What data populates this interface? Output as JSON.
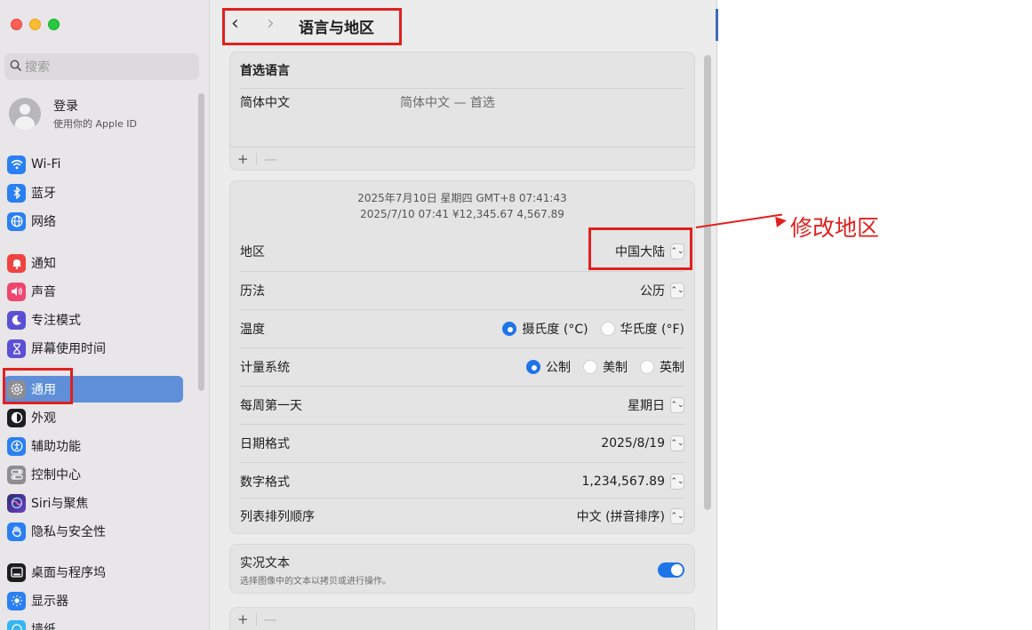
{
  "sidebar": {
    "search_placeholder": "搜索",
    "user": {
      "name": "登录",
      "subtitle": "使用你的 Apple ID"
    },
    "items": [
      {
        "label": "Wi-Fi",
        "icon": "wifi-icon",
        "color": "#2a7ff2"
      },
      {
        "label": "蓝牙",
        "icon": "bluetooth-icon",
        "color": "#2a7ff2"
      },
      {
        "label": "网络",
        "icon": "globe-icon",
        "color": "#2a7ff2"
      },
      {
        "label": "通知",
        "icon": "bell-icon",
        "color": "#ef4340"
      },
      {
        "label": "声音",
        "icon": "speaker-icon",
        "color": "#ef4670"
      },
      {
        "label": "专注模式",
        "icon": "moon-icon",
        "color": "#5b4fd6"
      },
      {
        "label": "屏幕使用时间",
        "icon": "hourglass-icon",
        "color": "#5b4fd6"
      },
      {
        "label": "通用",
        "icon": "gear-icon",
        "color": "#8d8d93"
      },
      {
        "label": "外观",
        "icon": "appearance-icon",
        "color": "#1d1d1f"
      },
      {
        "label": "辅助功能",
        "icon": "accessibility-icon",
        "color": "#2a7ff2"
      },
      {
        "label": "控制中心",
        "icon": "control-center-icon",
        "color": "#8d8d93"
      },
      {
        "label": "Siri与聚焦",
        "icon": "siri-icon",
        "color": "#3b3b6a"
      },
      {
        "label": "隐私与安全性",
        "icon": "hand-icon",
        "color": "#2a7ff2"
      },
      {
        "label": "桌面与程序坞",
        "icon": "dock-icon",
        "color": "#1d1d1f"
      },
      {
        "label": "显示器",
        "icon": "sun-icon",
        "color": "#2a7ff2"
      },
      {
        "label": "墙纸",
        "icon": "wallpaper-icon",
        "color": "#35b4f2"
      }
    ],
    "selected": "通用"
  },
  "toolbar": {
    "back": "‹",
    "forward": "›",
    "title": "语言与地区"
  },
  "preferred_languages": {
    "header": "首选语言",
    "languages": [
      {
        "name": "简体中文",
        "detail": "简体中文 — 首选"
      }
    ],
    "add": "+",
    "remove": "—"
  },
  "format_preview": {
    "line1": "2025年7月10日 星期四 GMT+8 07:41:43",
    "line2": "2025/7/10 07:41   ¥12,345.67   4,567.89"
  },
  "settings": {
    "region": {
      "label": "地区",
      "value": "中国大陆"
    },
    "calendar": {
      "label": "历法",
      "value": "公历"
    },
    "temperature": {
      "label": "温度",
      "options": [
        "摄氏度 (°C)",
        "华氏度 (°F)"
      ],
      "selected": "摄氏度 (°C)"
    },
    "measurement": {
      "label": "计量系统",
      "options": [
        "公制",
        "美制",
        "英制"
      ],
      "selected": "公制"
    },
    "first_day": {
      "label": "每周第一天",
      "value": "星期日"
    },
    "date_format": {
      "label": "日期格式",
      "value": "2025/8/19"
    },
    "number_format": {
      "label": "数字格式",
      "value": "1,234,567.89"
    },
    "list_sort": {
      "label": "列表排列顺序",
      "value": "中文 (拼音排序)"
    }
  },
  "live_text": {
    "title": "实况文本",
    "description": "选择图像中的文本以拷贝或进行操作。",
    "enabled": true
  },
  "apps_panel": {
    "add": "+",
    "remove": "—"
  },
  "annotation": {
    "text": "修改地区",
    "color": "#e0201e"
  }
}
